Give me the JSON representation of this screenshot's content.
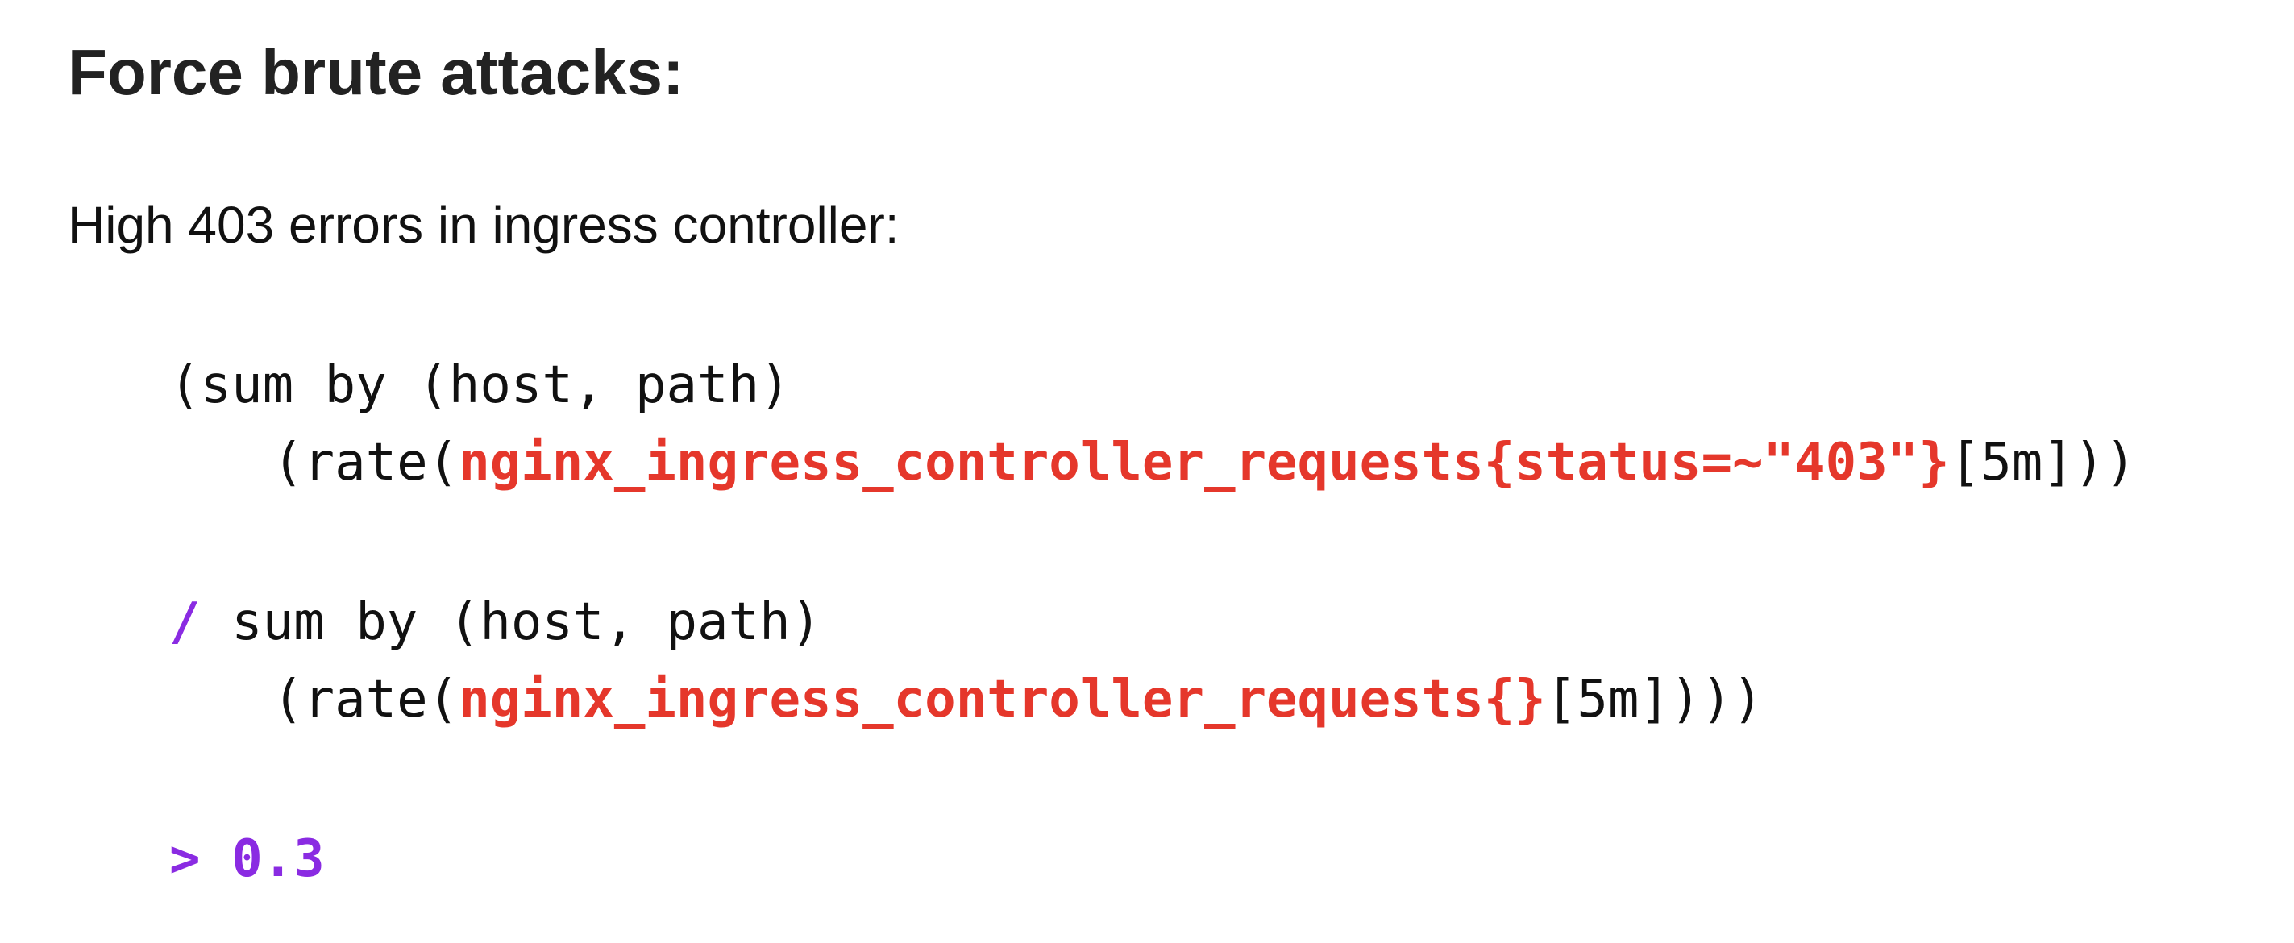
{
  "heading": "Force brute attacks:",
  "description": "High 403 errors in ingress controller:",
  "query": {
    "line1": "(sum by (host, path)",
    "line2": {
      "prefix": "(rate(",
      "metric": "nginx_ingress_controller_requests{status=~\"403\"}",
      "suffix": "[5m]))"
    },
    "line3": {
      "operator": "/",
      "text": " sum by (host, path)"
    },
    "line4": {
      "prefix": "(rate(",
      "metric": "nginx_ingress_controller_requests{}",
      "suffix": "[5m])))"
    },
    "threshold": "> 0.3"
  },
  "colors": {
    "metric": "#e5372b",
    "operator": "#8a2be2",
    "text": "#111111"
  }
}
